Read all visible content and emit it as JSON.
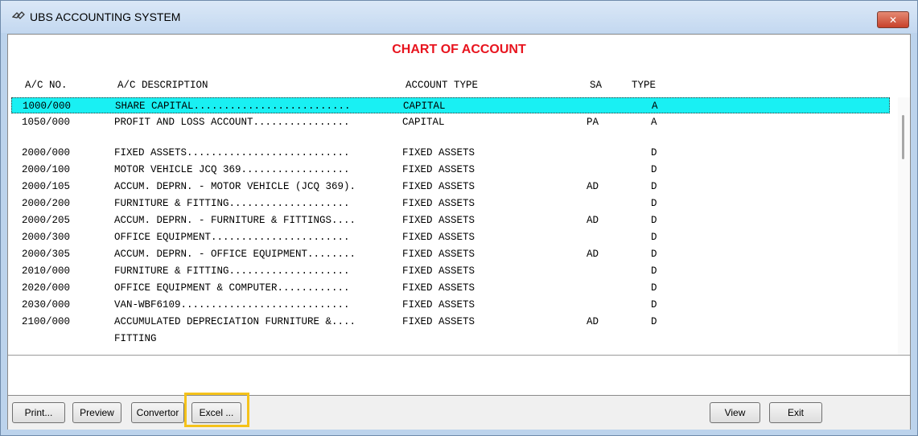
{
  "window": {
    "title": "UBS ACCOUNTING SYSTEM",
    "close_symbol": "✕"
  },
  "heading": "CHART OF ACCOUNT",
  "columns": {
    "ac_no": "A/C NO.",
    "description": "A/C DESCRIPTION",
    "account_type": "ACCOUNT TYPE",
    "sa": "SA",
    "type": "TYPE"
  },
  "rows": [
    {
      "ac_no": "1000/000",
      "description": "SHARE CAPITAL..........................",
      "account_type": "CAPITAL",
      "sa": "",
      "type": "A",
      "selected": true
    },
    {
      "ac_no": "1050/000",
      "description": "PROFIT AND LOSS ACCOUNT................",
      "account_type": "CAPITAL",
      "sa": "PA",
      "type": "A"
    },
    {
      "ac_no": "2000/000",
      "description": "FIXED ASSETS...........................",
      "account_type": "FIXED ASSETS",
      "sa": "",
      "type": "D"
    },
    {
      "ac_no": "2000/100",
      "description": "MOTOR VEHICLE JCQ 369..................",
      "account_type": "FIXED ASSETS",
      "sa": "",
      "type": "D"
    },
    {
      "ac_no": "2000/105",
      "description": "ACCUM. DEPRN. - MOTOR VEHICLE (JCQ 369).",
      "account_type": "FIXED ASSETS",
      "sa": "AD",
      "type": "D"
    },
    {
      "ac_no": "2000/200",
      "description": "FURNITURE & FITTING....................",
      "account_type": "FIXED ASSETS",
      "sa": "",
      "type": "D"
    },
    {
      "ac_no": "2000/205",
      "description": "ACCUM. DEPRN. - FURNITURE & FITTINGS....",
      "account_type": "FIXED ASSETS",
      "sa": "AD",
      "type": "D"
    },
    {
      "ac_no": "2000/300",
      "description": "OFFICE EQUIPMENT.......................",
      "account_type": "FIXED ASSETS",
      "sa": "",
      "type": "D"
    },
    {
      "ac_no": "2000/305",
      "description": "ACCUM. DEPRN. - OFFICE EQUIPMENT........",
      "account_type": "FIXED ASSETS",
      "sa": "AD",
      "type": "D"
    },
    {
      "ac_no": "2010/000",
      "description": "FURNITURE & FITTING....................",
      "account_type": "FIXED ASSETS",
      "sa": "",
      "type": "D"
    },
    {
      "ac_no": "2020/000",
      "description": "OFFICE EQUIPMENT & COMPUTER............",
      "account_type": "FIXED ASSETS",
      "sa": "",
      "type": "D"
    },
    {
      "ac_no": "2030/000",
      "description": "VAN-WBF6109............................",
      "account_type": "FIXED ASSETS",
      "sa": "",
      "type": "D"
    },
    {
      "ac_no": "2100/000",
      "description": "ACCUMULATED DEPRECIATION FURNITURE &....",
      "account_type": "FIXED ASSETS",
      "sa": "AD",
      "type": "D"
    },
    {
      "ac_no": "",
      "description": "FITTING",
      "account_type": "",
      "sa": "",
      "type": ""
    }
  ],
  "buttons": {
    "print": "Print...",
    "preview": "Preview",
    "convertor": "Convertor",
    "excel": "Excel ...",
    "view": "View",
    "exit": "Exit"
  },
  "highlight_color": "#f5c21b",
  "selection_color": "#19f0f3",
  "heading_color": "#e8141e"
}
